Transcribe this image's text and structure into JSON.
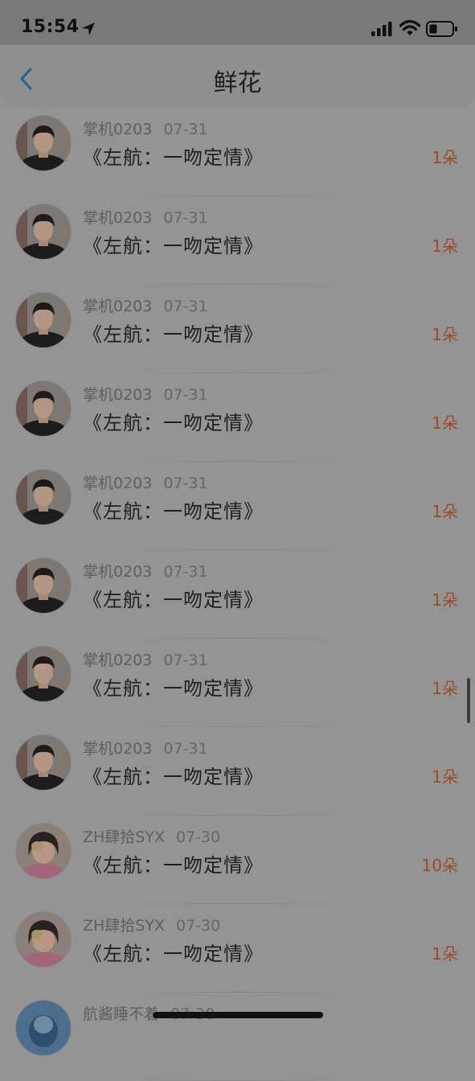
{
  "status_bar": {
    "time": "15:54"
  },
  "nav": {
    "title": "鲜花"
  },
  "rows": [
    {
      "user": "掌机0203",
      "date": "07-31",
      "song": "《左航：一吻定情》",
      "count": "1朵",
      "avatar": "boy"
    },
    {
      "user": "掌机0203",
      "date": "07-31",
      "song": "《左航：一吻定情》",
      "count": "1朵",
      "avatar": "boy"
    },
    {
      "user": "掌机0203",
      "date": "07-31",
      "song": "《左航：一吻定情》",
      "count": "1朵",
      "avatar": "boy"
    },
    {
      "user": "掌机0203",
      "date": "07-31",
      "song": "《左航：一吻定情》",
      "count": "1朵",
      "avatar": "boy"
    },
    {
      "user": "掌机0203",
      "date": "07-31",
      "song": "《左航：一吻定情》",
      "count": "1朵",
      "avatar": "boy"
    },
    {
      "user": "掌机0203",
      "date": "07-31",
      "song": "《左航：一吻定情》",
      "count": "1朵",
      "avatar": "boy"
    },
    {
      "user": "掌机0203",
      "date": "07-31",
      "song": "《左航：一吻定情》",
      "count": "1朵",
      "avatar": "boy"
    },
    {
      "user": "掌机0203",
      "date": "07-31",
      "song": "《左航：一吻定情》",
      "count": "1朵",
      "avatar": "boy"
    },
    {
      "user": "ZH肆拾SYX",
      "date": "07-30",
      "song": "《左航：一吻定情》",
      "count": "10朵",
      "avatar": "girl"
    },
    {
      "user": "ZH肆拾SYX",
      "date": "07-30",
      "song": "《左航：一吻定情》",
      "count": "1朵",
      "avatar": "girl"
    },
    {
      "user": "航酱睡不着",
      "date": "07-30",
      "song": "",
      "count": "",
      "avatar": "blue"
    }
  ]
}
